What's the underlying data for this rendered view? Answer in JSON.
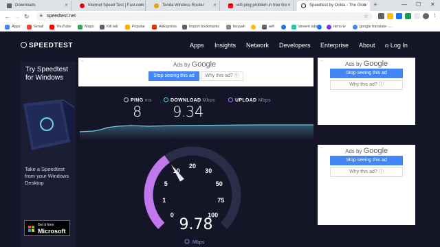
{
  "browser": {
    "tabs": [
      {
        "title": "Downloads",
        "icon": "download-icon",
        "color": "#5f6368",
        "active": false
      },
      {
        "title": "Internet Speed Test | Fast.com",
        "icon": "fast-com-icon",
        "color": "#e50914",
        "active": false
      },
      {
        "title": "Tenda Wireless Router",
        "icon": "tenda-icon",
        "color": "#e8a400",
        "active": false
      },
      {
        "title": "wifi ping problem in free fire -",
        "icon": "youtube-icon",
        "color": "#ff0000",
        "active": false
      },
      {
        "title": "Speedtest by Ookla - The Glob",
        "icon": "speedtest-icon",
        "color": "#141526",
        "active": true
      }
    ],
    "new_tab": "+",
    "window_controls": {
      "minimize": "—",
      "maximize": "☐",
      "close": "✕"
    },
    "nav": {
      "back": "←",
      "forward": "→",
      "reload": "↻"
    },
    "url": "speedtest.net",
    "bookmarks": [
      {
        "label": "Apps",
        "color": "#4285f4"
      },
      {
        "label": "Gmail",
        "color": "#ea4335"
      },
      {
        "label": "YouTube",
        "color": "#ff0000"
      },
      {
        "label": "Maps",
        "color": "#34a853"
      },
      {
        "label": "Kill tab",
        "color": "#5f6368"
      },
      {
        "label": "Popular",
        "color": "#f9ab00"
      },
      {
        "label": "AliExpress",
        "color": "#e62e04"
      },
      {
        "label": "Import bookmarks",
        "color": "#5f6368"
      },
      {
        "label": "boyyah",
        "color": "#8a8a8a"
      },
      {
        "label": "",
        "color": "#fbbc04"
      },
      {
        "label": "wifi",
        "color": "#5f6368"
      },
      {
        "label": "",
        "color": "#1a73e8"
      },
      {
        "label": "streem labs",
        "color": "#31c3a2"
      },
      {
        "label": "",
        "color": "#1877f2"
      },
      {
        "label": "nimo tv",
        "color": "#7b2ff7"
      },
      {
        "label": "google translate -...",
        "color": "#4285f4"
      }
    ]
  },
  "site": {
    "logo": "SPEEDTEST",
    "nav": [
      "Apps",
      "Insights",
      "Network",
      "Developers",
      "Enterprise",
      "About"
    ],
    "login": "Log In"
  },
  "left_ad": {
    "headline": "Try Speedtest for Windows",
    "subtext": "Take a Speedtest from your Windows Desktop",
    "badge_line1": "Get it from",
    "badge_line2": "Microsoft"
  },
  "ads": {
    "ads_by": "Ads by",
    "google": "Google",
    "stop": "Stop seeing this ad",
    "why": "Why this ad? ⓘ",
    "back": "←"
  },
  "results": {
    "ping_label": "PING",
    "ping_unit": "ms",
    "ping_value": "8",
    "download_label": "DOWNLOAD",
    "download_unit": "Mbps",
    "download_value": "9.34",
    "upload_label": "UPLOAD",
    "upload_unit": "Mbps",
    "upload_value": ""
  },
  "gauge": {
    "value": 9.78,
    "value_text": "9.78",
    "unit": "Mbps",
    "ticks": [
      {
        "label": "0",
        "v": 0
      },
      {
        "label": "1",
        "v": 1
      },
      {
        "label": "5",
        "v": 5
      },
      {
        "label": "10",
        "v": 10
      },
      {
        "label": "20",
        "v": 20
      },
      {
        "label": "30",
        "v": 30
      },
      {
        "label": "50",
        "v": 50
      },
      {
        "label": "75",
        "v": 75
      },
      {
        "label": "100",
        "v": 100
      }
    ],
    "colors": {
      "arc_fill": "#c178ec",
      "arc_track": "#2a2d47",
      "needle": "#e8e8f0"
    }
  },
  "colors": {
    "bg": "#141526",
    "accent": "#4285f4",
    "download": "#6fd0e6",
    "upload": "#b56cf2",
    "ping": "#d0d0e0"
  }
}
